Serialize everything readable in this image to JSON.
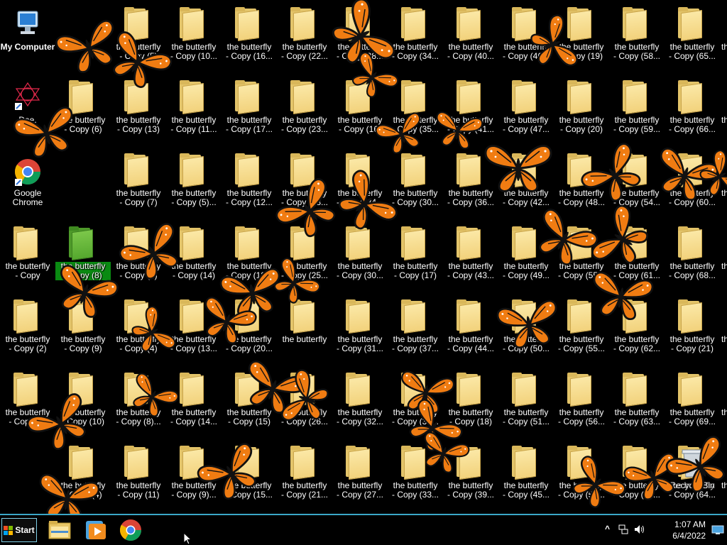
{
  "desktop": {
    "special": {
      "my_computer": "My Computer",
      "daemon": "Dae.\n...n...",
      "chrome": "Google\nChrome",
      "recycle": "Recycle Bin"
    },
    "grid": [
      [
        "the butterfly\n- Copy (5)",
        "the butterfly\n- Copy (10...",
        "the butterfly\n- Copy (16...",
        "the butterfly\n- Copy (22...",
        "the butterfly\n- Copy (28...",
        "the butterfly\n- Copy (34...",
        "the butterfly\n- Copy (40...",
        "the butterfly\n- Copy (46...",
        "the butterfly\n- Copy (19)",
        "the butterfly\n- Copy (58...",
        "the butterfly\n- Copy (65..."
      ],
      [
        "the butterfly\n- Copy (6)",
        "the butterfly\n- Copy (13)",
        "the butterfly\n- Copy (11...",
        "the butterfly\n- Copy (17...",
        "the butterfly\n- Copy (23...",
        "the butterfly\n- Copy (16)",
        "the butterfly\n- Copy (35...",
        "the butterfly\n- Copy (41...",
        "the butterfly\n- Copy (47...",
        "the butterfly\n- Copy (20)",
        "the butterfly\n- Copy (59...",
        "the butterfly\n- Copy (66..."
      ],
      [
        "the butterfly\n- Copy (7)",
        "the butterfly\n- Copy (5)...",
        "the butterfly\n- Copy (12...",
        "the butterfly\n- Copy (18...",
        "the butterfly\n- Copy (24...",
        "the butterfly\n- Copy (30...",
        "the butterfly\n- Copy (36...",
        "the butterfly\n- Copy (42...",
        "the butterfly\n- Copy (48...",
        "the butterfly\n- Copy (54...",
        "the butterfly\n- Copy (60..."
      ],
      [
        "the butterfly\n- Copy",
        "the butterfly\n- Copy (8)",
        "the butterfly\n- Copy (3)",
        "the butterfly\n- Copy (14)",
        "the butterfly\n- Copy (19...",
        "the butterfly\n- Copy (25...",
        "the butterfly\n- Copy (30...",
        "the butterfly\n- Copy (17)",
        "the butterfly\n- Copy (43...",
        "the butterfly\n- Copy (49...",
        "the butterfly\n- Copy (55...",
        "the butterfly\n- Copy (61...",
        "the butterfly\n- Copy (68..."
      ],
      [
        "the butterfly\n- Copy (2)",
        "the butterfly\n- Copy (9)",
        "the butterfly\n- Copy (4)",
        "the butterfly\n- Copy (13...",
        "the butterfly\n- Copy (20...",
        "the butterfly",
        "the butterfly\n- Copy (31...",
        "the butterfly\n- Copy (37...",
        "the butterfly\n- Copy (44...",
        "the butterfly\n- Copy (50...",
        "the butterfly\n- Copy (55...",
        "the butterfly\n- Copy (62...",
        "the butterfly\n- Copy (21)"
      ],
      [
        "the butterfly\n- Copy (3)",
        "the butterfly\n- Copy (10)",
        "the butterfly\n- Copy (8)...",
        "the butterfly\n- Copy (14...",
        "the butterfly\n- Copy (15)",
        "the butterfly\n- Copy (26...",
        "the butterfly\n- Copy (32...",
        "the butterfly\n- Copy (38...",
        "the butterfly\n- Copy (18)",
        "the butterfly\n- Copy (51...",
        "the butterfly\n- Copy (56...",
        "the butterfly\n- Copy (63...",
        "the butterfly\n- Copy (69..."
      ],
      [
        "the butterfly\n- Copy (4)",
        "the butterfly\n- Copy (11)",
        "the butterfly\n- Copy (9)...",
        "the butterfly\n- Copy (15...",
        "the butterfly\n- Copy (21...",
        "the butterfly\n- Copy (27...",
        "the butterfly\n- Copy (33...",
        "the butterfly\n- Copy (39...",
        "the butterfly\n- Copy (45...",
        "the butterfly\n- Copy (52...",
        "the butterfly\n- Copy (57...",
        "the butterfly\n- Copy (64..."
      ]
    ],
    "edge_label": "th"
  },
  "taskbar": {
    "start_label": "Start",
    "clock_time": "1:07 AM",
    "clock_date": "6/4/2022",
    "tray_chevron": "^"
  },
  "colors": {
    "folder": "#f2d27c",
    "folder_selected": "#55a82e",
    "selection_bg": "#0a8a12",
    "butterfly_orange": "#f07c12",
    "taskbar_border": "#3aa7c7"
  }
}
